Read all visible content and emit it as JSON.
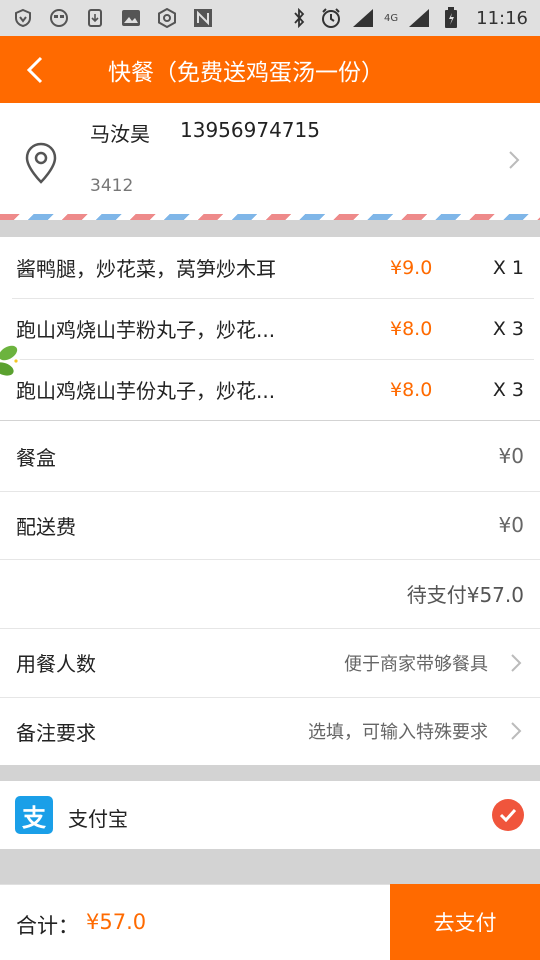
{
  "status_bar": {
    "time": "11:16",
    "network": "4G"
  },
  "header": {
    "title": "快餐（免费送鸡蛋汤一份）"
  },
  "address": {
    "name": "马汝昊",
    "phone": "13956974715",
    "line": "3412"
  },
  "order_items": [
    {
      "name": "酱鸭腿，炒花菜，莴笋炒木耳",
      "price": "¥9.0",
      "qty": "X 1"
    },
    {
      "name": "跑山鸡烧山芋粉丸子，炒花...",
      "price": "¥8.0",
      "qty": "X 3"
    },
    {
      "name": "跑山鸡烧山芋份丸子，炒花...",
      "price": "¥8.0",
      "qty": "X 3"
    }
  ],
  "fees": {
    "box_label": "餐盒",
    "box_value": "¥0",
    "delivery_label": "配送费",
    "delivery_value": "¥0"
  },
  "pending": {
    "text": "待支付¥57.0"
  },
  "options": {
    "diners_label": "用餐人数",
    "diners_hint": "便于商家带够餐具",
    "remarks_label": "备注要求",
    "remarks_hint": "选填，可输入特殊要求"
  },
  "payment": {
    "method": "支付宝",
    "icon_glyph": "支"
  },
  "footer": {
    "total_label": "合计：",
    "total_value": "¥57.0",
    "pay_button": "去支付"
  },
  "colors": {
    "accent": "#ff6a00",
    "alipay": "#1a9fe8",
    "check": "#f0553c"
  }
}
